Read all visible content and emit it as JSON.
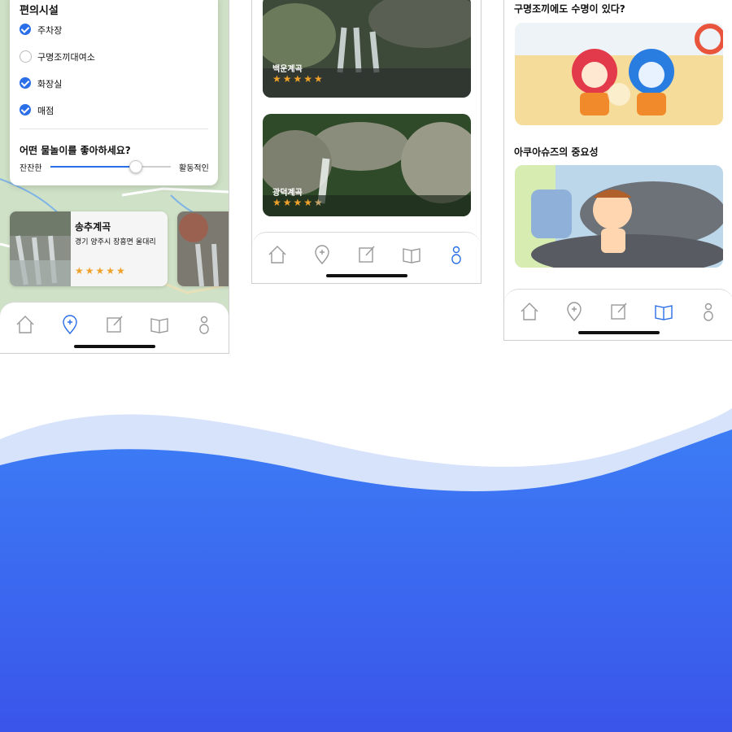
{
  "map_screen": {
    "filter_title": "편의시설",
    "options": [
      {
        "label": "주차장",
        "checked": true
      },
      {
        "label": "구명조끼대여소",
        "checked": false
      },
      {
        "label": "화장실",
        "checked": true
      },
      {
        "label": "매점",
        "checked": true
      }
    ],
    "question": "어떤 물놀이를 좋아하세요?",
    "slider": {
      "min_label": "잔잔한",
      "max_label": "활동적인",
      "value": 0.7
    },
    "place": {
      "name": "송추계곡",
      "address": "경기 양주시 장흥면 울대리",
      "rating": 5
    },
    "active_tab": "map"
  },
  "list_screen": {
    "items": [
      {
        "name": "백운계곡",
        "rating": 5
      },
      {
        "name": "광덕계곡",
        "rating": 4.5
      }
    ],
    "active_tab": "profile"
  },
  "guide_screen": {
    "articles": [
      {
        "title": "구명조끼에도 수명이 있다?"
      },
      {
        "title": "아쿠아슈즈의 중요성"
      }
    ],
    "active_tab": "book"
  },
  "tabs": [
    "home-icon",
    "map-pin-icon",
    "edit-icon",
    "book-icon",
    "person-icon"
  ],
  "colors": {
    "accent": "#2a6ee8",
    "wave_light": "#d6e3fb",
    "wave_top": "#3c7cf5",
    "wave_bottom": "#3a55ea",
    "star": "#f0a12a"
  }
}
